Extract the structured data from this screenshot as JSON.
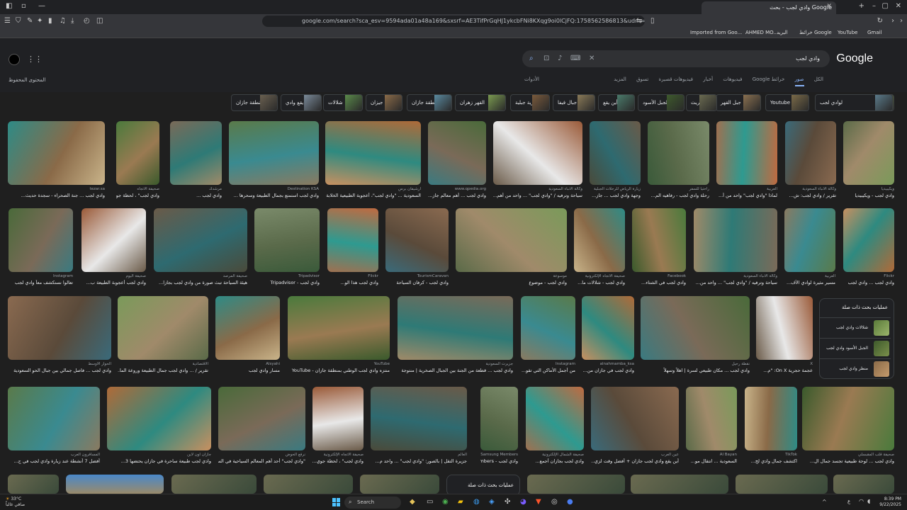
{
  "browser": {
    "tab_title": "وادي لجب - بحث Google",
    "url": "google.com/search?sca_esv=9594ada01a48a169&sxsrf=AE3TifPrGqHJ1ykcbFNi8KXqg9oi0lCjFQ:1758562586813&udm=2&fbs=AIIjpHya8RJaG7GTgO...",
    "bookmarks": [
      "Imported from Goo...",
      "AHMED MO...",
      "البريد",
      "خرائط Google",
      "YouTube",
      "Gmail"
    ]
  },
  "search": {
    "query": "وادي لجب",
    "logo": "Google",
    "nav_tabs": [
      "الكل",
      "صور",
      "خرائط Google",
      "فيديوهات",
      "أخبار",
      "فيديوهات قصيرة",
      "تسوق",
      "المزيد"
    ],
    "active_tab": "صور",
    "tools": "الأدوات",
    "safe_content": "المحتوى المحفوظ"
  },
  "chips": [
    "جازان",
    "لوادي لجب",
    "Youtube",
    "جبل القهر",
    "جبال الريث",
    "الجبل الأسود",
    "أين يقع",
    "جبال فيفا",
    "قرية جبلية",
    "القهر زهران",
    "منطقة جازان",
    "جيزان",
    "شلالات",
    "يقع وادي",
    "بمنطقة جازان"
  ],
  "rows": [
    [
      {
        "src": "tezar.sa",
        "title": "وادي لجب ... جنة الصحراء - سجدة حديث..."
      },
      {
        "src": "صحيفة الاتجاه",
        "title": "وادي لجب\" ، لحظة جوي..."
      },
      {
        "src": "مرشدك",
        "title": "وادي لجب ..."
      },
      {
        "src": "Destination KSA",
        "title": "وادي لجب استمتع بجمال الطبيعة وسحرها ..."
      },
      {
        "src": "أرشيفان برس",
        "title": "السعودية ... \"وادي لجب\"، أعجوبة الطبيعية الخلابة"
      },
      {
        "src": "www.qpedia.org",
        "title": "وادي لجب ... أهم معالم جاز..."
      },
      {
        "src": "وكالة الأنباء السعودية",
        "title": "سياحة وترفيه / \"وادي لجب\" ... واحد من أهم..."
      },
      {
        "src": "زيارة الرياض للرحلات الجبلية",
        "title": "وجهة وادي لجب ... جاز..."
      },
      {
        "src": "راحتيا للسفر",
        "title": "رحلة وادي لجب - رفاهيه الم..."
      },
      {
        "src": "العربية",
        "title": "لماذا \"وادي لجب\" واحد من أ..."
      },
      {
        "src": "وكالة الأنباء السعودية",
        "title": "تقرير / وادي لجب: ش..."
      },
      {
        "src": "ويكيبيديا",
        "title": "وادي لجب - ويكيبيديا"
      }
    ],
    [
      {
        "src": "Instagram",
        "title": "تعالوا نستكشف معاً وادي لجب"
      },
      {
        "src": "صحيفة اليوم",
        "title": "وادي لجب أعجوبة الطبيعة ب..."
      },
      {
        "src": "صحيفة المرصد",
        "title": "هيئة السياحة تبث صورة من وادي لجب بجازا..."
      },
      {
        "src": "Tripadvisor",
        "title": "وادي لجب - Tripadvisor"
      },
      {
        "src": "Flickr",
        "title": "وادي لجب هذا الو..."
      },
      {
        "src": "TourismCaravan",
        "title": "وادي لجب - كرفان السياحة"
      },
      {
        "src": "موسوعة",
        "title": "وادي لجب - موضوع"
      },
      {
        "src": "صحيفة الاتجاه الإلكترونية",
        "title": "وادي لجب - شلالات ما..."
      },
      {
        "src": "Facebook",
        "title": "وادي لجب في الشتاء..."
      },
      {
        "src": "وكالة الأنباء السعودية",
        "title": "سياحة وترفيه / \"وادي لجب\" ... واحد من..."
      },
      {
        "src": "العربية",
        "title": "مسير مثيرة لوادي الأف..."
      },
      {
        "src": "Flickr",
        "title": "وادي لجب ... وادي لجب"
      }
    ],
    [
      {
        "src": "الحوار الأوسط",
        "title": "وادي لجب ... فاصل جمالي بين جبال الحو السعودية"
      },
      {
        "src": "الاقتصادية",
        "title": "تقرير / ... وادي لجب جمال الطبيعة وروعة الما..."
      },
      {
        "src": "Alsyahi",
        "title": "مسار وادي لجب"
      },
      {
        "src": "YouTube",
        "title": "منتزه وادي لجب الوطني بمنطقة جازان - YouTube"
      },
      {
        "src": "جزيرت السعودية",
        "title": "وادي لجب ... قطعة من الجنة بين الجبال الصخرية | منتوجة"
      },
      {
        "src": "Instagram",
        "title": "من أجمل الأماكن التي تقو..."
      },
      {
        "src": "alnahmamba_ksa",
        "title": "وادي لجب في جازان من..."
      },
      {
        "src": "نقطة رحيل",
        "title": "وادي لجب ... مكان طبيعي لسرة | اهلاً وسهلاً"
      },
      {
        "src": "X",
        "title": "عجمة حجرية On X: \"م..."
      }
    ],
    [
      {
        "src": "المسافرون العرب",
        "title": "أفضل 7 أنشطة عند زيارة وادي لجب في ج..."
      },
      {
        "src": "جازان أون لاين",
        "title": "وادي لجب طبيعة ساحرة في جازان يحتضها 3..."
      },
      {
        "src": "نرفع الحوض",
        "title": "\"وادي لجب\" أحد أهم المعالم السياحية في الس..."
      },
      {
        "src": "صحيفة الاتجاه الإلكترونية",
        "title": "وادي لجب\" ، لحظة جوي..."
      },
      {
        "src": "العالم",
        "title": "جزيرة التقل | بالصور: \"وادي لجب\" ... واحد م..."
      },
      {
        "src": "Samsung Members",
        "title": "وادي لجب - Samsung Members"
      },
      {
        "src": "صحيفة الشمال الإلكترونية",
        "title": "وادي لجب بجازان أجمع..."
      },
      {
        "src": "عين العرب",
        "title": "أين يقع وادي لجب جازان + أفضل وقت لزي..."
      },
      {
        "src": "Al Bayan",
        "title": "السعودية ... انتقال مو..."
      },
      {
        "src": "TikTok",
        "title": "اكتشف جمال وادي لج..."
      },
      {
        "src": "صحيفة قلب المقبسلي",
        "title": "وادي لجب ... لوحة طبيعية تجسد جمال ال..."
      }
    ]
  ],
  "related": {
    "heading": "عمليات بحث ذات صلة",
    "items": [
      "شلالات وادي لجب",
      "الجبل الأسود وادي لجب",
      "منظر وادي لجب"
    ]
  },
  "related2_heading": "عمليات بحث ذات صلة",
  "taskbar": {
    "weather_temp": "33°C",
    "weather_desc": "صافي غالباً",
    "search_label": "Search",
    "time": "8:39 PM",
    "date": "9/22/2025",
    "lang": "ع"
  }
}
